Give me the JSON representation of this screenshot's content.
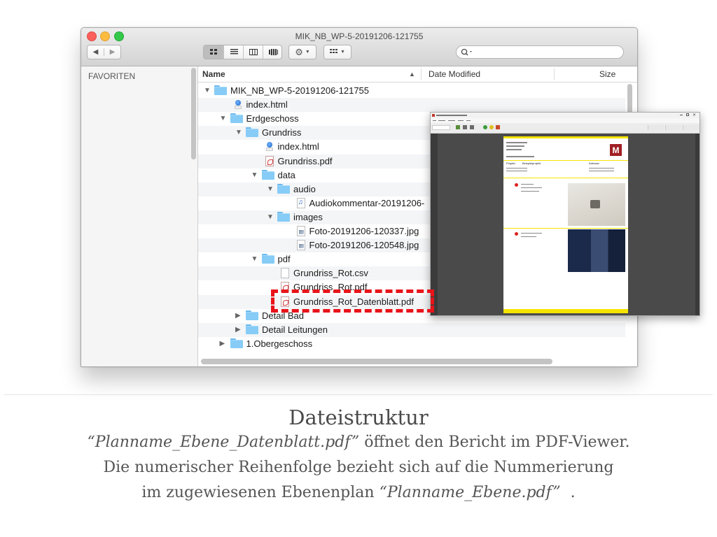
{
  "window": {
    "title": "MIK_NB_WP-5-20191206-121755"
  },
  "toolbar": {
    "back": "◀",
    "forward": "▶",
    "action_icon": "gear-icon",
    "search_placeholder": ""
  },
  "sidebar": {
    "heading": "FAVORITEN"
  },
  "columns": {
    "name": "Name",
    "date_modified": "Date Modified",
    "size": "Size"
  },
  "rows": [
    {
      "name": "MIK_NB_WP-5-20191206-121755",
      "kind": "folder",
      "level": 0,
      "toggle": "open"
    },
    {
      "name": "index.html",
      "kind": "html",
      "level": 1,
      "toggle": ""
    },
    {
      "name": "Erdgeschoss",
      "kind": "folder",
      "level": 1,
      "toggle": "open"
    },
    {
      "name": "Grundriss",
      "kind": "folder",
      "level": 2,
      "toggle": "open"
    },
    {
      "name": "index.html",
      "kind": "html",
      "level": 3,
      "toggle": ""
    },
    {
      "name": "Grundriss.pdf",
      "kind": "pdf",
      "level": 3,
      "toggle": ""
    },
    {
      "name": "data",
      "kind": "folder",
      "level": 3,
      "toggle": "open"
    },
    {
      "name": "audio",
      "kind": "folder",
      "level": 4,
      "toggle": "open"
    },
    {
      "name": "Audiokommentar-20191206-",
      "kind": "audio",
      "level": 5,
      "toggle": ""
    },
    {
      "name": "images",
      "kind": "folder",
      "level": 4,
      "toggle": "open"
    },
    {
      "name": "Foto-20191206-120337.jpg",
      "kind": "image",
      "level": 5,
      "toggle": ""
    },
    {
      "name": "Foto-20191206-120548.jpg",
      "kind": "image",
      "level": 5,
      "toggle": ""
    },
    {
      "name": "pdf",
      "kind": "folder",
      "level": 3,
      "toggle": "open"
    },
    {
      "name": "Grundriss_Rot.csv",
      "kind": "doc",
      "level": 4,
      "toggle": ""
    },
    {
      "name": "Grundriss_Rot.pdf",
      "kind": "pdf",
      "level": 4,
      "toggle": ""
    },
    {
      "name": "Grundriss_Rot_Datenblatt.pdf",
      "kind": "pdf",
      "level": 4,
      "toggle": "",
      "highlighted": true
    },
    {
      "name": "Detail Bad",
      "kind": "folder",
      "level": 2,
      "toggle": "closed"
    },
    {
      "name": "Detail Leitungen",
      "kind": "folder",
      "level": 2,
      "toggle": "closed"
    },
    {
      "name": "1.Obergeschoss",
      "kind": "folder",
      "level": 1,
      "toggle": "closed"
    }
  ],
  "viewer": {
    "page_logo": "M",
    "page_labels": [
      "Projekt:",
      "Beispielprojekt",
      "Adresse"
    ]
  },
  "caption": {
    "title": "Dateistruktur",
    "line1_italic": "“Planname_Ebene_Datenblatt.pdf”",
    "line1_rest": " öffnet den Bericht im PDF-Viewer.",
    "line2": "Die numerischer Reihenfolge bezieht sich auf die Nummerierung",
    "line3_start": "im zugewiesenen Ebenenplan ",
    "line3_italic": "“Planname_Ebene.pdf”",
    "line3_end": "  ."
  },
  "colors": {
    "highlight_dash": "#e8141a",
    "folder_blue": "#87ccf6",
    "viewer_yellow": "#f5e400",
    "logo_red": "#a01f24"
  }
}
